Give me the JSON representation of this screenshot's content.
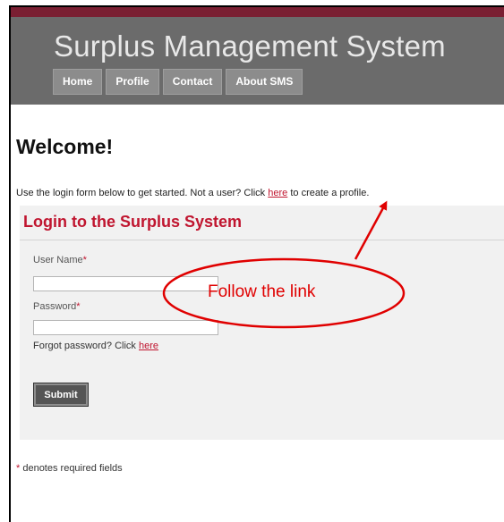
{
  "header": {
    "app_title": "Surplus Management System",
    "nav": [
      "Home",
      "Profile",
      "Contact",
      "About SMS"
    ]
  },
  "main": {
    "welcome_title": "Welcome!",
    "intro_before": "Use the login form below to get started. Not a user? Click ",
    "intro_link": "here",
    "intro_after": " to create a profile."
  },
  "login": {
    "heading": "Login to the Surplus System",
    "username_label": "User Name",
    "password_label": "Password",
    "required_mark": "*",
    "username_value": "",
    "password_value": "",
    "forgot_text": "Forgot password? Click ",
    "forgot_link": "here",
    "submit_label": "Submit"
  },
  "footer": {
    "required_mark": "*",
    "required_note": " denotes required fields"
  },
  "annotation": {
    "callout": "Follow the link",
    "color": "#e00000"
  },
  "colors": {
    "brand_maroon": "#7a1f32",
    "header_gray": "#6b6b6b",
    "accent_red": "#c0152f"
  }
}
